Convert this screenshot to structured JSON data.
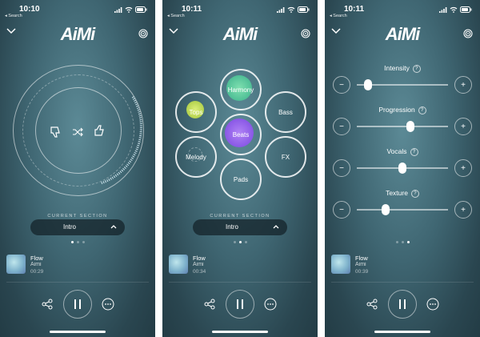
{
  "screens": [
    {
      "status_time": "10:10",
      "status_back": "◂ Search",
      "logo": "AiMi",
      "section_label": "CURRENT SECTION",
      "section_value": "Intro",
      "track_title": "Flow",
      "track_artist": "Aimi",
      "track_time": "00:29",
      "page_index": 0
    },
    {
      "status_time": "10:11",
      "status_back": "◂ Search",
      "logo": "AiMi",
      "section_label": "CURRENT SECTION",
      "section_value": "Intro",
      "track_title": "Flow",
      "track_artist": "Aimi",
      "track_time": "00:34",
      "page_index": 1,
      "nodes": [
        "Harmony",
        "Tops",
        "Bass",
        "Beats",
        "Melody",
        "FX",
        "Pads"
      ]
    },
    {
      "status_time": "10:11",
      "status_back": "◂ Search",
      "logo": "AiMi",
      "track_title": "Flow",
      "track_artist": "Aimi",
      "track_time": "00:39",
      "page_index": 2,
      "controls": [
        {
          "label": "Intensity",
          "help": "?",
          "minus": "−",
          "plus": "+",
          "value_fraction": 0.12
        },
        {
          "label": "Progression",
          "help": "?",
          "minus": "−",
          "plus": "+",
          "value_fraction": 0.59
        },
        {
          "label": "Vocals",
          "help": "?",
          "minus": "−",
          "plus": "+",
          "value_fraction": 0.5
        },
        {
          "label": "Texture",
          "help": "?",
          "minus": "−",
          "plus": "+",
          "value_fraction": 0.32
        }
      ]
    }
  ],
  "icons": {
    "collapse": "chevron-down-icon",
    "broadcast": "broadcast-icon",
    "share": "share-icon",
    "pause": "pause-icon",
    "more": "more-icon",
    "dislike": "thumbs-down-icon",
    "shuffle": "shuffle-icon",
    "like": "thumbs-up-icon"
  },
  "colors": {
    "harmony_glow": "#7fe0b0",
    "tops_glow": "#c9e36a",
    "beats_glow": "#a56ef0"
  }
}
